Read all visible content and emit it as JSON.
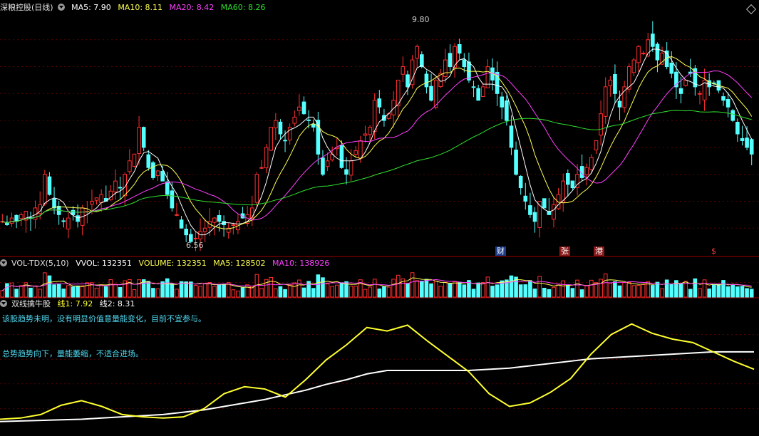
{
  "main": {
    "title": "深粮控股(日线)",
    "ma5_label": "MA5: 7.90",
    "ma10_label": "MA10: 8.11",
    "ma20_label": "MA20: 8.42",
    "ma60_label": "MA60: 8.26",
    "high_label": "9.80",
    "low_label": "6.56",
    "tags": [
      "财",
      "张",
      "港",
      "$"
    ]
  },
  "volume": {
    "title": "VOL-TDX(5,10)",
    "vvol_label": "VVOL: 132351",
    "volume_label": "VOLUME: 132351",
    "ma5_label": "MA5: 128502",
    "ma10_label": "MA10: 138926"
  },
  "indicator": {
    "title": "双线擒牛股",
    "line1_label": "线1: 7.92",
    "line2_label": "线2: 8.31",
    "note1": "该股趋势未明，没有明显价值意量能变化，目前不宜参与。",
    "note2": "总势趋势向下，量能萎缩，不适合进场。"
  },
  "colors": {
    "up": "#ff3030",
    "down": "#54ffff",
    "ma5": "#ffffff",
    "ma10": "#ffff50",
    "ma20": "#ff40ff",
    "ma60": "#30e030",
    "line1": "#ffff30",
    "line2": "#ffffff"
  },
  "chart_data": {
    "type": "candlestick",
    "price_range": [
      6.4,
      10.0
    ],
    "high": 9.8,
    "low": 6.56,
    "closes": [
      6.9,
      6.85,
      6.95,
      6.9,
      7.0,
      7.05,
      6.95,
      7.1,
      7.15,
      7.6,
      7.3,
      7.1,
      7.0,
      6.9,
      6.95,
      7.0,
      6.9,
      7.1,
      7.05,
      7.2,
      7.25,
      7.3,
      7.2,
      7.35,
      7.5,
      7.4,
      7.6,
      7.8,
      7.9,
      8.3,
      8.0,
      7.7,
      7.55,
      7.65,
      7.5,
      7.3,
      7.1,
      7.0,
      6.8,
      6.7,
      6.6,
      6.65,
      6.75,
      6.8,
      6.9,
      6.95,
      6.9,
      6.85,
      6.8,
      6.85,
      6.9,
      6.95,
      7.0,
      7.1,
      7.6,
      7.7,
      8.0,
      8.3,
      8.4,
      8.2,
      8.1,
      8.3,
      8.45,
      8.6,
      8.5,
      8.4,
      8.3,
      7.9,
      7.6,
      7.8,
      7.9,
      8.0,
      7.7,
      7.6,
      7.8,
      7.95,
      8.1,
      8.2,
      8.3,
      8.7,
      8.6,
      8.4,
      8.5,
      8.7,
      9.0,
      9.2,
      8.9,
      9.3,
      9.5,
      9.2,
      8.9,
      8.7,
      9.0,
      9.1,
      9.3,
      9.2,
      9.5,
      9.4,
      9.2,
      9.0,
      8.9,
      8.7,
      8.9,
      9.2,
      9.0,
      8.8,
      8.6,
      8.4,
      8.0,
      7.6,
      7.4,
      7.2,
      7.0,
      6.9,
      7.2,
      7.1,
      7.0,
      7.15,
      7.3,
      7.5,
      7.45,
      7.4,
      7.6,
      7.55,
      7.7,
      7.85,
      8.1,
      8.5,
      8.9,
      9.0,
      8.8,
      8.6,
      8.9,
      9.2,
      9.3,
      9.5,
      9.4,
      9.6,
      9.5,
      9.3,
      9.4,
      9.2,
      9.1,
      8.9,
      8.8,
      9.0,
      9.1,
      8.9,
      8.8,
      9.0,
      8.9,
      8.95,
      8.85,
      8.7,
      8.6,
      8.4,
      8.2,
      8.1,
      8.0,
      7.9
    ],
    "volume_range": [
      0,
      400000
    ],
    "line1_sample": [
      1.2,
      1.3,
      1.6,
      2.4,
      2.8,
      2.3,
      1.6,
      1.4,
      1.3,
      1.4,
      2.1,
      3.4,
      4.0,
      3.8,
      3.1,
      4.6,
      6.3,
      7.6,
      9.1,
      8.8,
      9.3,
      7.9,
      6.6,
      5.3,
      3.4,
      2.3,
      2.6,
      3.5,
      4.7,
      6.8,
      8.5,
      9.4,
      8.6,
      8.1,
      7.8,
      7.0,
      6.2,
      5.5
    ],
    "line2_sample": [
      1.0,
      1.05,
      1.1,
      1.15,
      1.2,
      1.3,
      1.4,
      1.5,
      1.6,
      1.8,
      2.0,
      2.3,
      2.6,
      2.9,
      3.3,
      3.7,
      4.2,
      4.6,
      5.1,
      5.4,
      5.4,
      5.4,
      5.4,
      5.4,
      5.5,
      5.6,
      5.8,
      6.0,
      6.2,
      6.4,
      6.5,
      6.6,
      6.7,
      6.8,
      6.9,
      7.0,
      7.0,
      7.0
    ],
    "indicator_range": [
      0,
      10
    ],
    "xlabel": "",
    "ylabel": ""
  }
}
